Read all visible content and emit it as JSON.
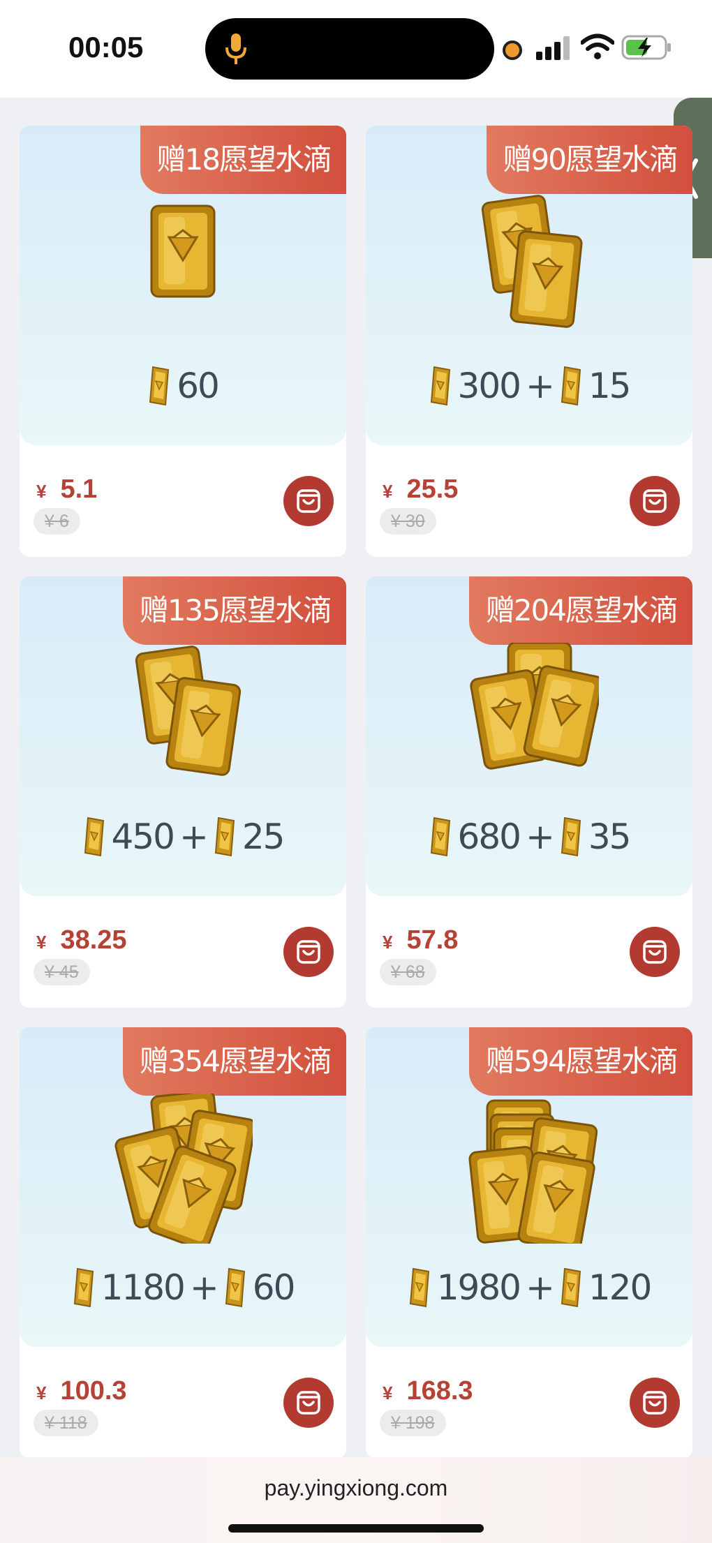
{
  "status_bar": {
    "time": "00:05"
  },
  "products": [
    {
      "gift": "赠18愿望水滴",
      "base": "60",
      "bonus": "",
      "yen": "¥",
      "price": "5.1",
      "original": "¥ 6"
    },
    {
      "gift": "赠90愿望水滴",
      "base": "300",
      "bonus": "15",
      "yen": "¥",
      "price": "25.5",
      "original": "¥ 30"
    },
    {
      "gift": "赠135愿望水滴",
      "base": "450",
      "bonus": "25",
      "yen": "¥",
      "price": "38.25",
      "original": "¥ 45"
    },
    {
      "gift": "赠204愿望水滴",
      "base": "680",
      "bonus": "35",
      "yen": "¥",
      "price": "57.8",
      "original": "¥ 68"
    },
    {
      "gift": "赠354愿望水滴",
      "base": "1180",
      "bonus": "60",
      "yen": "¥",
      "price": "100.3",
      "original": "¥ 118"
    },
    {
      "gift": "赠594愿望水滴",
      "base": "1980",
      "bonus": "120",
      "yen": "¥",
      "price": "168.3",
      "original": "¥ 198"
    }
  ],
  "plus_sign": "+",
  "browser": {
    "url": "pay.yingxiong.com"
  },
  "colors": {
    "accent_red": "#b23a31",
    "badge_gradient_start": "#e17a5e",
    "badge_gradient_end": "#d24f3c"
  }
}
